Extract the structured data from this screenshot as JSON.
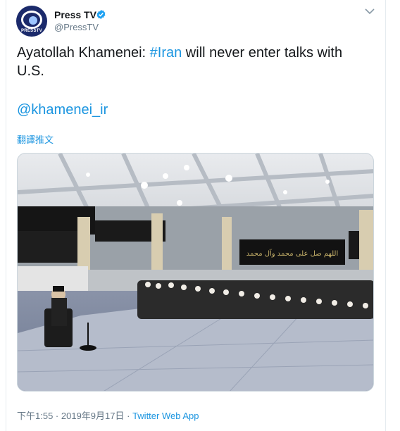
{
  "account": {
    "name": "Press TV",
    "handle": "@PressTV",
    "avatar_label": "PRESSTV",
    "verified": true
  },
  "tweet": {
    "text_before": "Ayatollah Khamenei: ",
    "hashtag": "#Iran",
    "text_after": " will never enter talks with U.S.",
    "mention": "@khamenei_ir",
    "translate_label": "翻譯推文"
  },
  "photo": {
    "banner_text": "اللهم صل على محمد وآل محمد"
  },
  "meta": {
    "time": "下午1:55",
    "date": "2019年9月17日",
    "separator": " · ",
    "source": "Twitter Web App"
  },
  "colors": {
    "link": "#1b95e0",
    "secondary": "#657786",
    "verified_badge": "#1da1f2"
  },
  "icons": {
    "verified": "verified-badge-icon",
    "menu": "chevron-down-icon"
  }
}
